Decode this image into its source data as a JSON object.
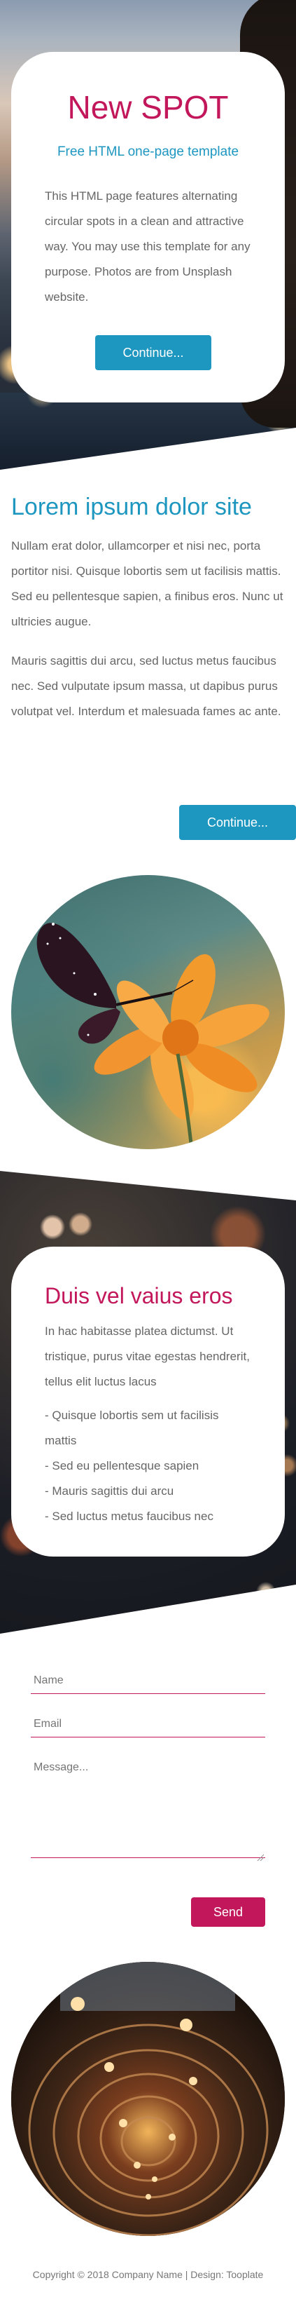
{
  "hero": {
    "title": "New SPOT",
    "subtitle": "Free HTML one-page template",
    "text": "This HTML page features alternating circular spots in a clean and attractive way. You may use this template for any purpose. Photos are from Unsplash website.",
    "button_label": "Continue..."
  },
  "section2": {
    "title": "Lorem ipsum dolor site",
    "paragraph1": "Nullam erat dolor, ullamcorper et nisi nec, porta portitor nisi. Quisque lobortis sem ut facilisis mattis. Sed eu pellentesque sapien, a finibus eros. Nunc ut ultricies augue.",
    "paragraph2": "Mauris sagittis dui arcu, sed luctus metus faucibus nec. Sed vulputate ipsum massa, ut dapibus purus volutpat vel. Interdum et malesuada fames ac ante.",
    "button_label": "Continue..."
  },
  "section3": {
    "title": "Duis vel vaius eros",
    "paragraph": "In hac habitasse platea dictumst. Ut tristique, purus vitae egestas hendrerit, tellus elit luctus lacus",
    "list": [
      "- Quisque lobortis sem ut facilisis mattis",
      "- Sed eu pellentesque sapien",
      "- Mauris sagittis dui arcu",
      "- Sed luctus metus faucibus nec"
    ]
  },
  "contact_form": {
    "name_placeholder": "Name",
    "email_placeholder": "Email",
    "message_placeholder": "Message...",
    "send_label": "Send"
  },
  "footer": {
    "text": "Copyright © 2018 Company Name | Design: Tooplate"
  },
  "colors": {
    "accent_magenta": "#c2185b",
    "accent_blue": "#1e97c0"
  }
}
